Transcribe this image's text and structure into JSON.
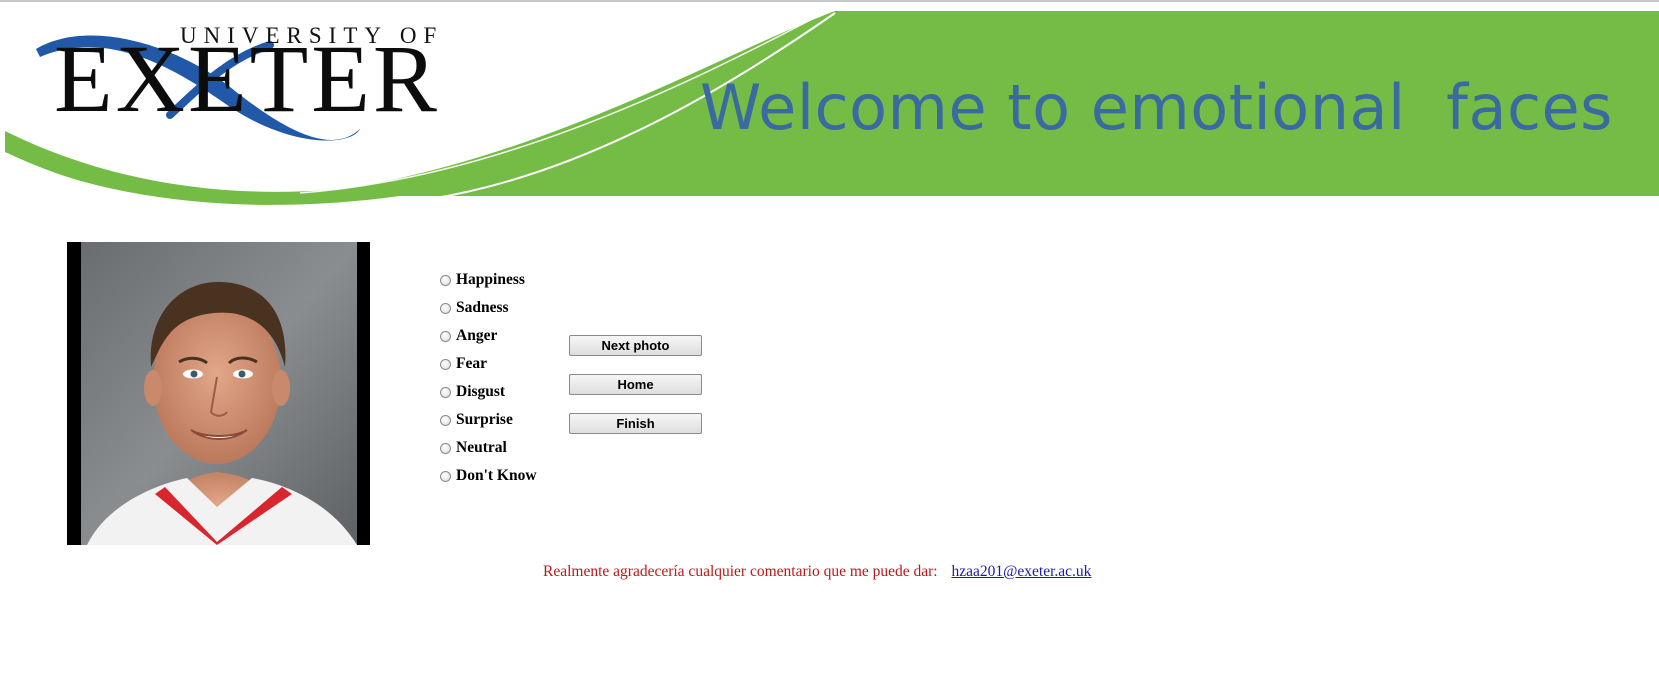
{
  "header": {
    "logo": {
      "line1": "UNIVERSITY OF",
      "line2": "EXETER"
    },
    "welcome_text": "Welcome to emotional  faces"
  },
  "colors": {
    "banner_green": "#74bc45",
    "welcome_blue": "#3b6aa0",
    "logo_blue": "#2159a8",
    "feedback_red": "#c0161a",
    "link_blue": "#1a1ab0"
  },
  "photo": {
    "icon": "face-photo"
  },
  "emotions": {
    "options": [
      {
        "label": "Happiness"
      },
      {
        "label": "Sadness"
      },
      {
        "label": "Anger"
      },
      {
        "label": "Fear"
      },
      {
        "label": "Disgust"
      },
      {
        "label": "Surprise"
      },
      {
        "label": "Neutral"
      },
      {
        "label": "Don't Know"
      }
    ]
  },
  "buttons": {
    "next_photo": "Next photo",
    "home": "Home",
    "finish": "Finish"
  },
  "footer": {
    "feedback_text": "Realmente agradecería cualquier comentario que me puede dar:",
    "email": "hzaa201@exeter.ac.uk"
  }
}
